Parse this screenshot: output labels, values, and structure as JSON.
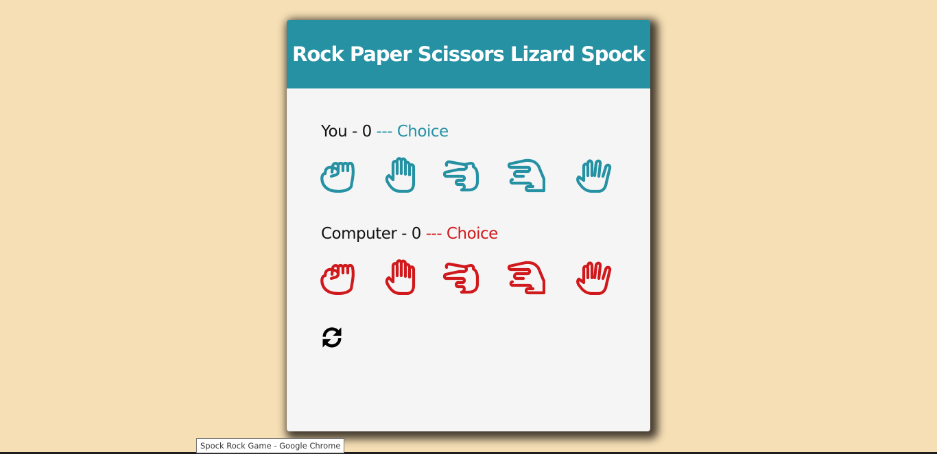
{
  "game": {
    "title": "Rock Paper Scissors Lizard Spock",
    "player": {
      "label": "You - ",
      "score": "0",
      "choice_label": " --- Choice",
      "color": "#2591a3"
    },
    "computer": {
      "label": "Computer - ",
      "score": "0",
      "choice_label": " --- Choice",
      "color": "#d0191c"
    },
    "options": [
      {
        "name": "rock",
        "icon": "fist-hand-icon"
      },
      {
        "name": "paper",
        "icon": "open-hand-icon"
      },
      {
        "name": "scissors",
        "icon": "scissors-hand-icon"
      },
      {
        "name": "lizard",
        "icon": "lizard-hand-icon"
      },
      {
        "name": "spock",
        "icon": "spock-hand-icon"
      }
    ],
    "reset_icon": "refresh-icon"
  },
  "colors": {
    "background": "#f6dfb5",
    "header": "#2591a3",
    "card": "#f5f5f6",
    "player_accent": "#2591a3",
    "computer_accent": "#d0191c"
  },
  "tooltip": {
    "text": "Spock Rock Game - Google Chrome"
  }
}
